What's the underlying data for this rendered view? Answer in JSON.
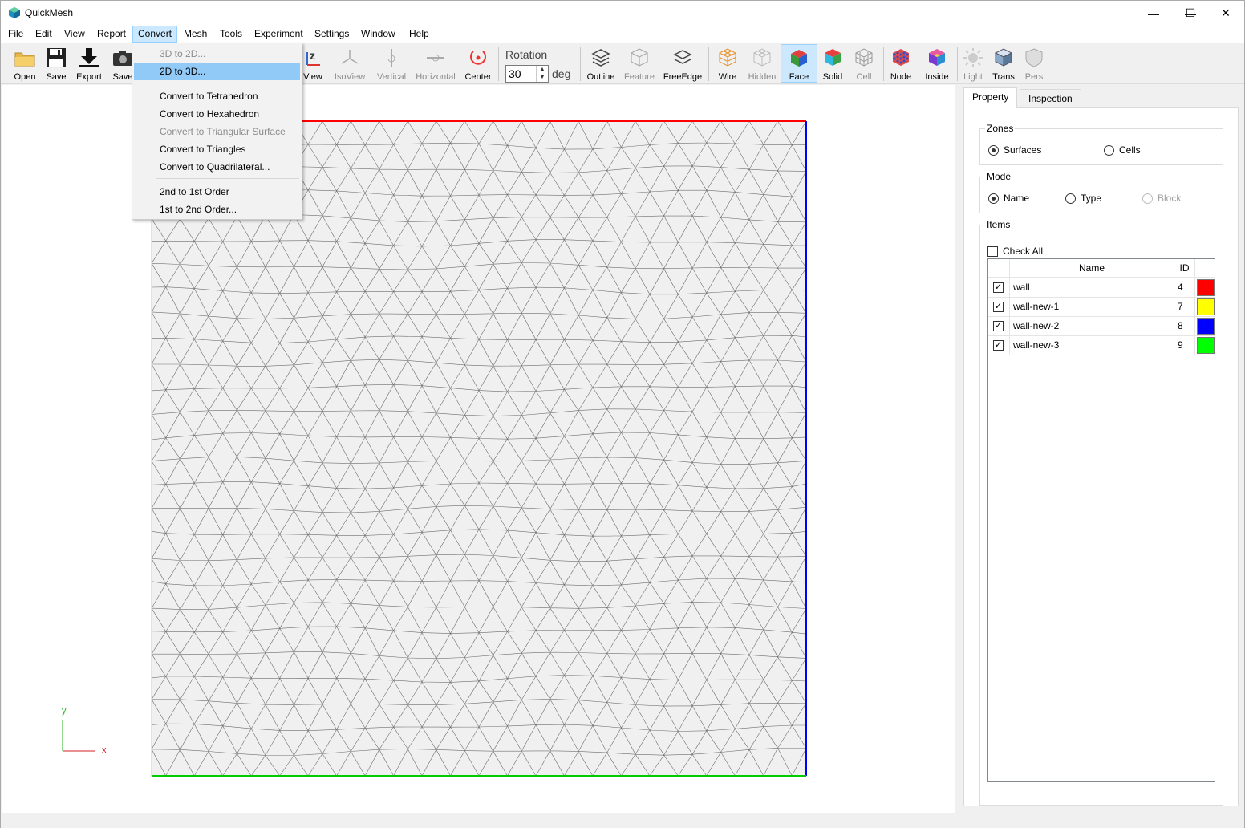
{
  "window": {
    "title": "QuickMesh",
    "controls": [
      "—",
      "☐",
      "✕"
    ]
  },
  "menubar": {
    "items": [
      "File",
      "Edit",
      "View",
      "Report",
      "Convert",
      "Mesh",
      "Tools",
      "Experiment",
      "Settings",
      "Window",
      "Help"
    ],
    "active": "Convert"
  },
  "toolbar": {
    "buttons": [
      {
        "label": "Open",
        "icon": "folder-icon"
      },
      {
        "label": "Save",
        "icon": "floppy-icon"
      },
      {
        "label": "Export",
        "icon": "download-icon"
      },
      {
        "label": "Save",
        "icon": "camera-icon"
      },
      {
        "label": "View",
        "icon": "xz-view-icon"
      },
      {
        "label": "IsoView",
        "icon": "iso-view-icon"
      },
      {
        "label": "Vertical",
        "icon": "vertical-icon"
      },
      {
        "label": "Horizontal",
        "icon": "horizontal-icon"
      },
      {
        "label": "Center",
        "icon": "center-icon"
      },
      {
        "label": "Outline",
        "icon": "outline-icon"
      },
      {
        "label": "Feature",
        "icon": "feature-icon"
      },
      {
        "label": "FreeEdge",
        "icon": "free-edge-icon"
      },
      {
        "label": "Wire",
        "icon": "wire-icon"
      },
      {
        "label": "Hidden",
        "icon": "hidden-icon"
      },
      {
        "label": "Face",
        "icon": "face-icon"
      },
      {
        "label": "Solid",
        "icon": "solid-icon"
      },
      {
        "label": "Cell",
        "icon": "cell-icon"
      },
      {
        "label": "Node",
        "icon": "node-icon"
      },
      {
        "label": "Inside",
        "icon": "inside-icon"
      },
      {
        "label": "Light",
        "icon": "light-icon"
      },
      {
        "label": "Trans",
        "icon": "trans-icon"
      },
      {
        "label": "Pers",
        "icon": "pers-icon"
      }
    ],
    "rotation": {
      "label": "Rotation",
      "value": "30",
      "unit": "deg"
    }
  },
  "convert_menu": {
    "items": [
      {
        "label": "3D to 2D...",
        "enabled": false
      },
      {
        "label": "2D to 3D...",
        "enabled": true,
        "highlighted": true
      },
      {
        "label": "Convert to Tetrahedron",
        "enabled": true
      },
      {
        "label": "Convert to Hexahedron",
        "enabled": true
      },
      {
        "label": "Convert to Triangular Surface",
        "enabled": false
      },
      {
        "label": "Convert to Triangles",
        "enabled": true
      },
      {
        "label": "Convert to Quadrilateral...",
        "enabled": true
      },
      {
        "label": "2nd to 1st Order",
        "enabled": true
      },
      {
        "label": "1st to 2nd Order...",
        "enabled": true
      }
    ]
  },
  "viewport": {
    "axis_y": "y",
    "axis_x": "x",
    "boundary_colors": {
      "top": "#ff0000",
      "left": "#ffff00",
      "right": "#0000ff",
      "bottom": "#00cc00"
    }
  },
  "panel": {
    "tabs": [
      "Property",
      "Inspection"
    ],
    "active_tab": "Property",
    "zones": {
      "title": "Zones",
      "options": [
        "Surfaces",
        "Cells"
      ],
      "selected": "Surfaces"
    },
    "mode": {
      "title": "Mode",
      "options": [
        "Name",
        "Type",
        "Block"
      ],
      "selected": "Name",
      "disabled": [
        "Block"
      ]
    },
    "items": {
      "title": "Items",
      "check_all": "Check All",
      "columns": [
        "Name",
        "ID"
      ],
      "rows": [
        {
          "name": "wall",
          "id": "4",
          "color": "#ff0000",
          "checked": true
        },
        {
          "name": "wall-new-1",
          "id": "7",
          "color": "#ffff00",
          "checked": true
        },
        {
          "name": "wall-new-2",
          "id": "8",
          "color": "#0000ff",
          "checked": true
        },
        {
          "name": "wall-new-3",
          "id": "9",
          "color": "#00ff00",
          "checked": true
        }
      ]
    }
  }
}
